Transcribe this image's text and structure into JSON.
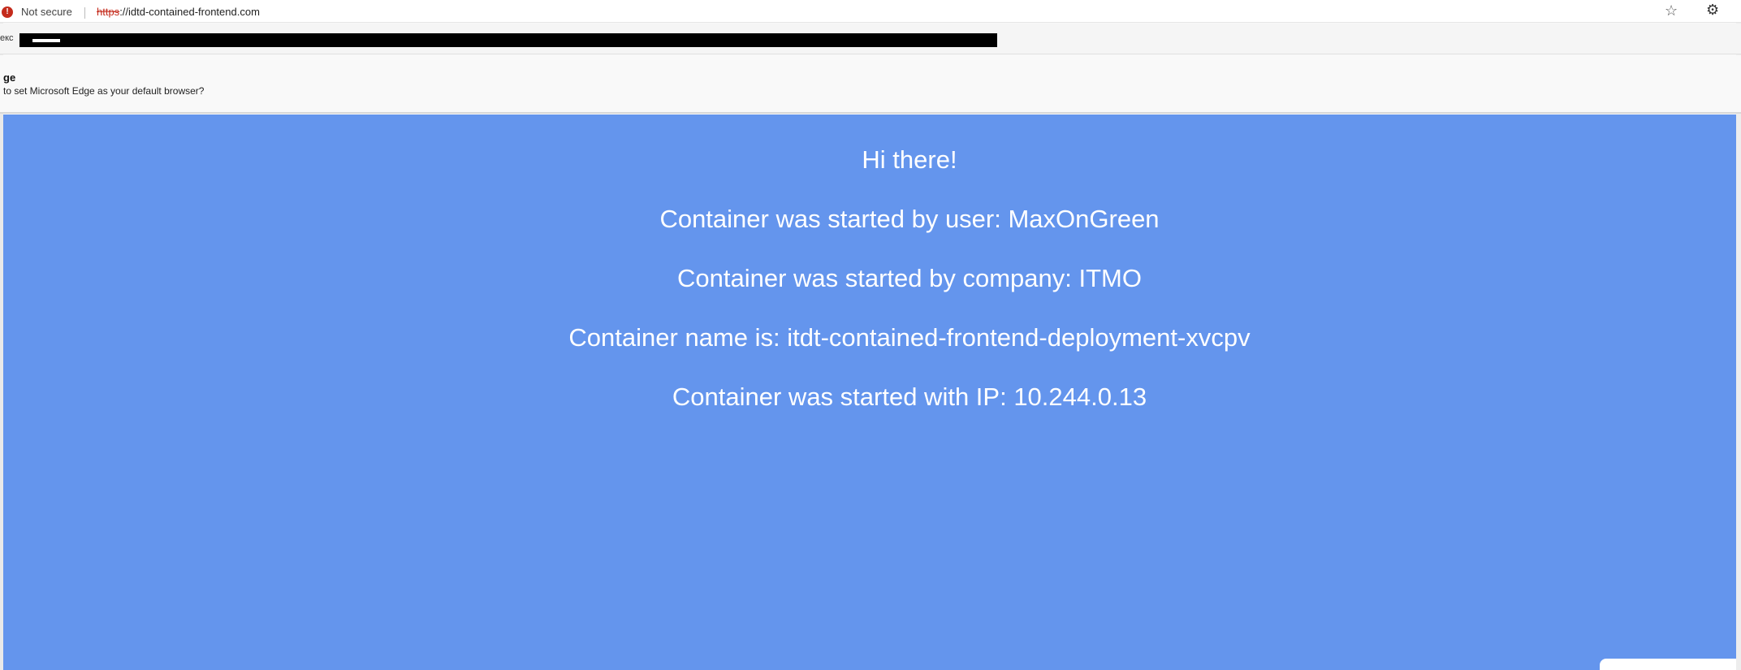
{
  "browser": {
    "security_label": "Not secure",
    "url_scheme": "https",
    "url_rest": "://idtd-contained-frontend.com",
    "favorites_label": "екс",
    "icons": {
      "warning": "warning-icon",
      "favorite": "star-icon",
      "extensions": "puzzle-icon"
    }
  },
  "infobar": {
    "title": "ge",
    "text": "to set Microsoft Edge as your default browser?"
  },
  "page": {
    "background_color": "#6495ed",
    "greeting": "Hi there!",
    "user_line": "Container was started by user: MaxOnGreen",
    "company_line": "Container was started by company: ITMO",
    "name_line": "Container name is: itdt-contained-frontend-deployment-xvcpv",
    "ip_line": "Container was started with IP: 10.244.0.13"
  }
}
